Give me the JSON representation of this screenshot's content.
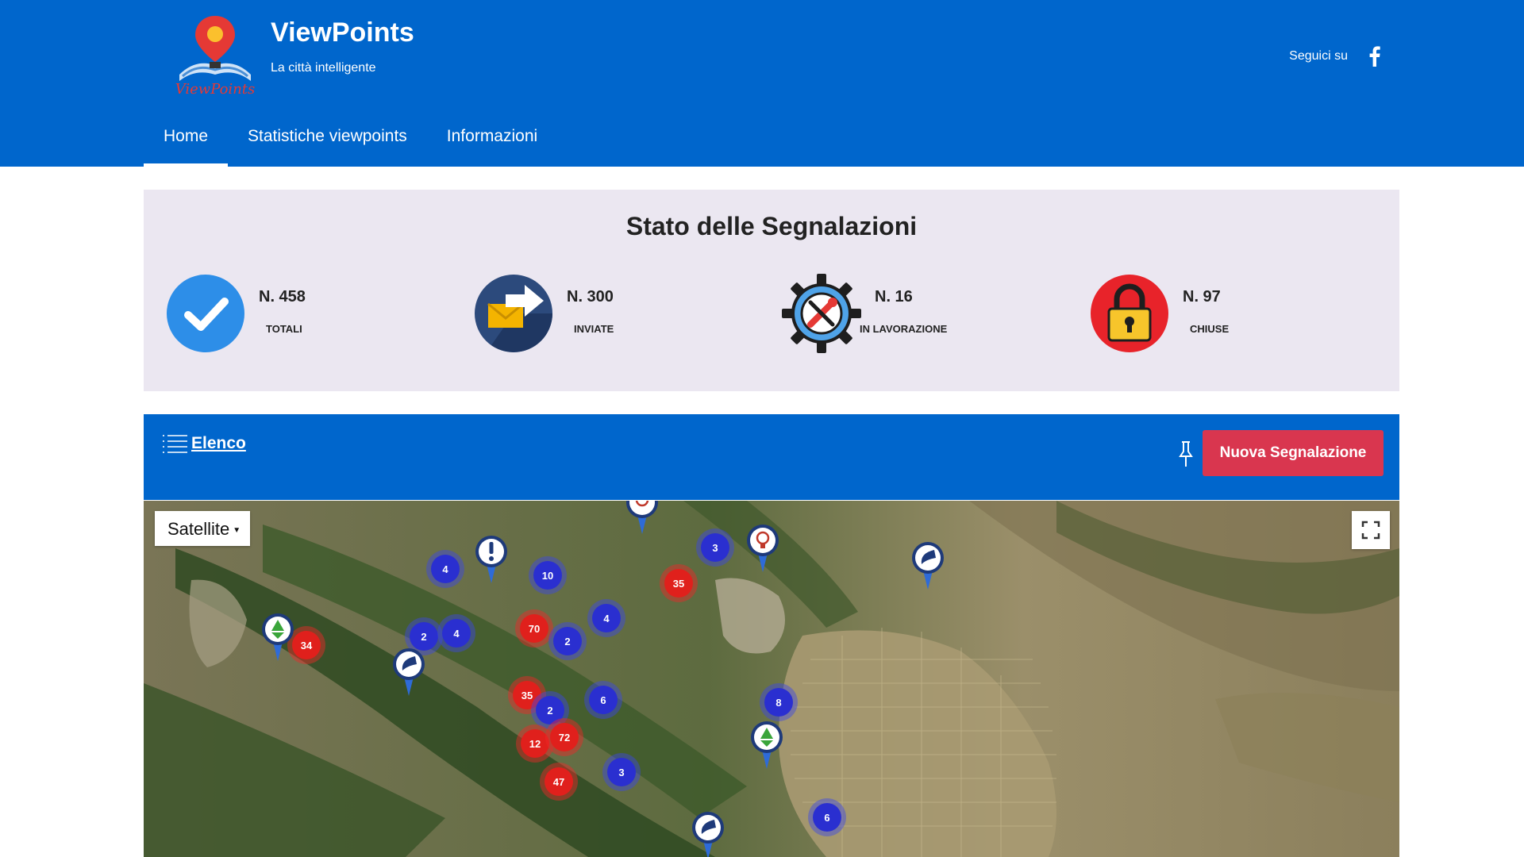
{
  "header": {
    "brand_title": "ViewPoints",
    "brand_subtitle": "La città intelligente",
    "logo_icon": "viewpoints-logo",
    "logo_wordmark": "ViewPoints",
    "follow_label": "Seguici su",
    "social_icon": "facebook-icon"
  },
  "nav": [
    {
      "label": "Home",
      "active": true
    },
    {
      "label": "Statistiche viewpoints",
      "active": false
    },
    {
      "label": "Informazioni",
      "active": false
    }
  ],
  "status": {
    "title": "Stato delle Segnalazioni",
    "items": [
      {
        "number": "N. 458",
        "label": "TOTALI",
        "icon": "check-circle-icon"
      },
      {
        "number": "N. 300",
        "label": "INVIATE",
        "icon": "envelope-arrow-icon"
      },
      {
        "number": "N. 16",
        "label": "IN LAVORAZIONE",
        "icon": "gear-wrench-icon"
      },
      {
        "number": "N. 97",
        "label": "CHIUSE",
        "icon": "padlock-icon"
      }
    ]
  },
  "toolbar": {
    "list_label": "Elenco",
    "list_icon": "list-icon",
    "pin_icon": "pin-icon",
    "new_report_label": "Nuova Segnalazione"
  },
  "map": {
    "layer_label": "Satellite",
    "fullscreen_icon": "fullscreen-icon",
    "clusters": [
      {
        "count": "4",
        "color": "blue"
      },
      {
        "count": "10",
        "color": "blue"
      },
      {
        "count": "3",
        "color": "blue"
      },
      {
        "count": "35",
        "color": "red"
      },
      {
        "count": "34",
        "color": "red"
      },
      {
        "count": "70",
        "color": "red"
      },
      {
        "count": "4",
        "color": "blue"
      },
      {
        "count": "2",
        "color": "blue"
      },
      {
        "count": "4",
        "color": "blue"
      },
      {
        "count": "2",
        "color": "blue"
      },
      {
        "count": "35",
        "color": "red"
      },
      {
        "count": "2",
        "color": "blue"
      },
      {
        "count": "6",
        "color": "blue"
      },
      {
        "count": "8",
        "color": "blue"
      },
      {
        "count": "12",
        "color": "red"
      },
      {
        "count": "72",
        "color": "red"
      },
      {
        "count": "47",
        "color": "red"
      },
      {
        "count": "3",
        "color": "blue"
      },
      {
        "count": "6",
        "color": "blue"
      }
    ],
    "markers": [
      {
        "type": "warning-marker-icon"
      },
      {
        "type": "lightbulb-marker-icon"
      },
      {
        "type": "road-marker-icon"
      },
      {
        "type": "recycle-marker-icon"
      },
      {
        "type": "road-marker-icon"
      },
      {
        "type": "recycle-marker-icon"
      },
      {
        "type": "road-marker-icon"
      },
      {
        "type": "lightbulb-marker-icon"
      }
    ]
  },
  "colors": {
    "brand_blue": "#0066cc",
    "panel_bg": "#ebe7f1",
    "button_red": "#d9364f",
    "cluster_blue": "#2a2fd0",
    "cluster_red": "#e0201c"
  }
}
